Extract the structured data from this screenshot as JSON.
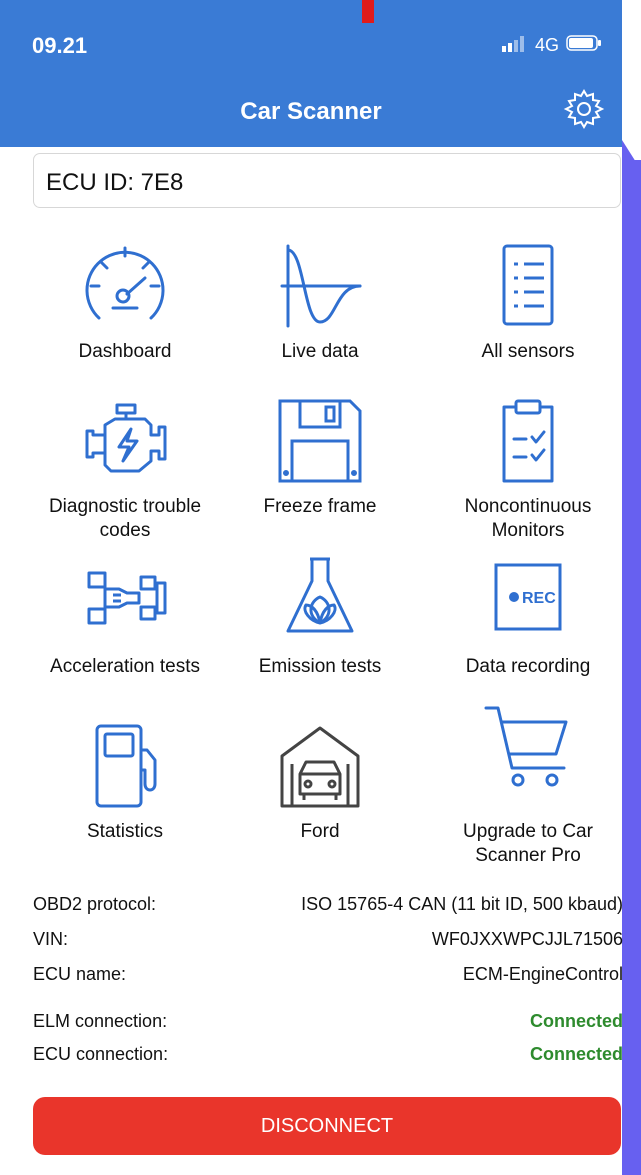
{
  "status_bar": {
    "time": "09.21",
    "network": "4G"
  },
  "header": {
    "title": "Car Scanner"
  },
  "ecu_box": {
    "text": "ECU ID: 7E8"
  },
  "tiles": [
    {
      "label": "Dashboard",
      "icon": "gauge-icon"
    },
    {
      "label": "Live data",
      "icon": "sine-wave-icon"
    },
    {
      "label": "All sensors",
      "icon": "list-icon"
    },
    {
      "label": "Diagnostic trouble codes",
      "icon": "engine-icon"
    },
    {
      "label": "Freeze frame",
      "icon": "floppy-disk-icon"
    },
    {
      "label": "Noncontinuous Monitors",
      "icon": "clipboard-checklist-icon"
    },
    {
      "label": "Acceleration tests",
      "icon": "race-car-icon"
    },
    {
      "label": "Emission tests",
      "icon": "flask-leaf-icon"
    },
    {
      "label": "Data recording",
      "icon": "rec-icon",
      "badge": "REC"
    },
    {
      "label": "Statistics",
      "icon": "fuel-pump-icon"
    },
    {
      "label": "Ford",
      "icon": "garage-car-icon"
    },
    {
      "label": "Upgrade to Car Scanner Pro",
      "icon": "shopping-cart-icon"
    }
  ],
  "info": {
    "protocol_label": "OBD2 protocol:",
    "protocol_value": "ISO 15765-4 CAN (11 bit ID, 500 kbaud)",
    "vin_label": "VIN:",
    "vin_value": "WF0JXXWPCJJL71506",
    "ecu_name_label": "ECU name:",
    "ecu_name_value": "ECM-EngineControl",
    "elm_label": "ELM connection:",
    "elm_value": "Connected",
    "ecu_conn_label": "ECU connection:",
    "ecu_conn_value": "Connected"
  },
  "actions": {
    "disconnect": "DISCONNECT"
  },
  "colors": {
    "accent": "#3a7bd5",
    "status_ok": "#2e8b2e",
    "danger": "#e9352b"
  }
}
